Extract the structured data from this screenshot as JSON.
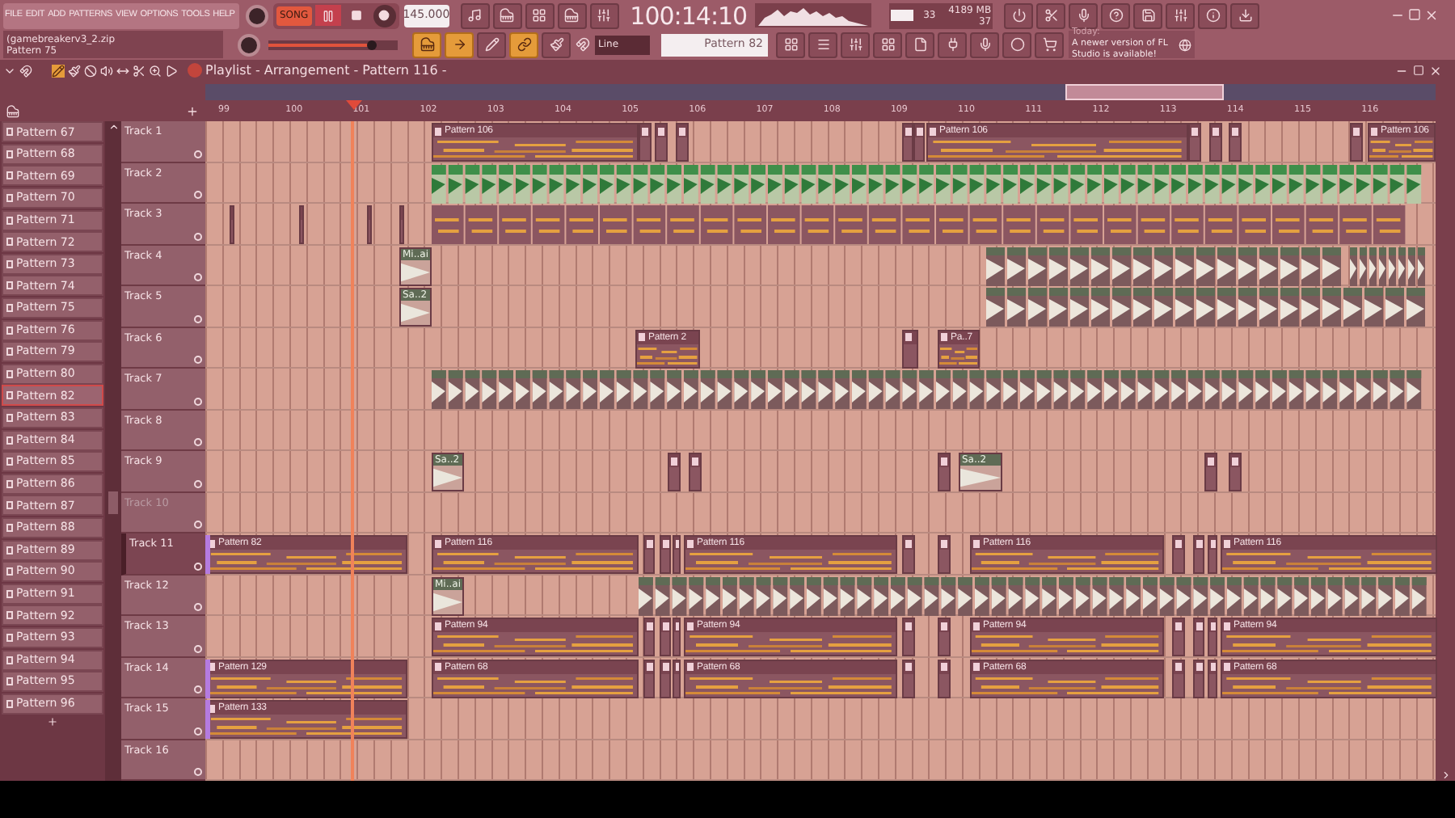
{
  "menu": [
    "FILE",
    "EDIT",
    "ADD",
    "PATTERNS",
    "VIEW",
    "OPTIONS",
    "TOOLS",
    "HELP"
  ],
  "transport": {
    "mode": "SONG",
    "tempo": "145.000",
    "time": "100:14:10"
  },
  "project": {
    "file": "(gamebreakerv3_2.zip",
    "hint": "Pattern 75"
  },
  "monitor": {
    "cpu": "33",
    "memory": "4189 MB",
    "polyphony": "37"
  },
  "snap": "Line",
  "volume": {
    "level": 0.8
  },
  "pattern_selector": "Pattern 82",
  "news": {
    "label": "Today:",
    "message": "A newer version of FL Studio is available!"
  },
  "playlist_title": "Playlist - Arrangement - Pattern 116 -",
  "ruler": [
    "99",
    "100",
    "101",
    "102",
    "103",
    "104",
    "105",
    "106",
    "107",
    "108",
    "109",
    "110",
    "111",
    "112",
    "113",
    "114",
    "115",
    "116"
  ],
  "patterns": [
    {
      "label": "Pattern 67",
      "selected": false
    },
    {
      "label": "Pattern 68",
      "selected": false
    },
    {
      "label": "Pattern 69",
      "selected": false
    },
    {
      "label": "Pattern 70",
      "selected": false
    },
    {
      "label": "Pattern 71",
      "selected": false
    },
    {
      "label": "Pattern 72",
      "selected": false
    },
    {
      "label": "Pattern 73",
      "selected": false
    },
    {
      "label": "Pattern 74",
      "selected": false
    },
    {
      "label": "Pattern 75",
      "selected": false
    },
    {
      "label": "Pattern 76",
      "selected": false
    },
    {
      "label": "Pattern 79",
      "selected": false
    },
    {
      "label": "Pattern 80",
      "selected": false
    },
    {
      "label": "Pattern 82",
      "selected": true
    },
    {
      "label": "Pattern 83",
      "selected": false
    },
    {
      "label": "Pattern 84",
      "selected": false
    },
    {
      "label": "Pattern 85",
      "selected": false
    },
    {
      "label": "Pattern 86",
      "selected": false
    },
    {
      "label": "Pattern 87",
      "selected": false
    },
    {
      "label": "Pattern 88",
      "selected": false
    },
    {
      "label": "Pattern 89",
      "selected": false
    },
    {
      "label": "Pattern 90",
      "selected": false
    },
    {
      "label": "Pattern 91",
      "selected": false
    },
    {
      "label": "Pattern 92",
      "selected": false
    },
    {
      "label": "Pattern 93",
      "selected": false
    },
    {
      "label": "Pattern 94",
      "selected": false
    },
    {
      "label": "Pattern 95",
      "selected": false
    },
    {
      "label": "Pattern 96",
      "selected": false
    }
  ],
  "tracks": [
    {
      "name": "Track 1",
      "muted": false,
      "selected": false,
      "clips": [
        {
          "kind": "pattern",
          "label": "Pattern 106"
        },
        {
          "kind": "pattern",
          "label": "Pattern 106"
        },
        {
          "kind": "pattern",
          "label": "Pattern 106"
        }
      ]
    },
    {
      "name": "Track 2",
      "muted": false,
      "selected": false
    },
    {
      "name": "Track 3",
      "muted": false,
      "selected": false
    },
    {
      "name": "Track 4",
      "muted": false,
      "selected": false,
      "clips": [
        {
          "kind": "audio",
          "label": "Mi..ai"
        }
      ]
    },
    {
      "name": "Track 5",
      "muted": false,
      "selected": false,
      "clips": [
        {
          "kind": "audio",
          "label": "Sa..2"
        }
      ]
    },
    {
      "name": "Track 6",
      "muted": false,
      "selected": false,
      "clips": [
        {
          "kind": "pattern",
          "label": "Pattern 2"
        },
        {
          "kind": "pattern",
          "label": "Pa..7"
        }
      ]
    },
    {
      "name": "Track 7",
      "muted": false,
      "selected": false
    },
    {
      "name": "Track 8",
      "muted": false,
      "selected": false
    },
    {
      "name": "Track 9",
      "muted": false,
      "selected": false,
      "clips": [
        {
          "kind": "audio",
          "label": "Sa..2"
        },
        {
          "kind": "audio",
          "label": "Sa..2"
        }
      ]
    },
    {
      "name": "Track 10",
      "muted": true,
      "selected": false
    },
    {
      "name": "Track 11",
      "muted": false,
      "selected": true,
      "clips": [
        {
          "kind": "pattern",
          "label": "Pattern 82"
        },
        {
          "kind": "pattern",
          "label": "Pattern 116"
        },
        {
          "kind": "pattern",
          "label": "Pattern 116"
        },
        {
          "kind": "pattern",
          "label": "Pattern 116"
        },
        {
          "kind": "pattern",
          "label": "Pattern 116"
        }
      ]
    },
    {
      "name": "Track 12",
      "muted": false,
      "selected": false,
      "clips": [
        {
          "kind": "audio",
          "label": "Mi..ai"
        }
      ]
    },
    {
      "name": "Track 13",
      "muted": false,
      "selected": false,
      "clips": [
        {
          "kind": "pattern",
          "label": "Pattern 94"
        },
        {
          "kind": "pattern",
          "label": "Pattern 94"
        },
        {
          "kind": "pattern",
          "label": "Pattern 94"
        },
        {
          "kind": "pattern",
          "label": "Pattern 94"
        }
      ]
    },
    {
      "name": "Track 14",
      "muted": false,
      "selected": false,
      "clips": [
        {
          "kind": "pattern",
          "label": "Pattern 129"
        },
        {
          "kind": "pattern",
          "label": "Pattern 68"
        },
        {
          "kind": "pattern",
          "label": "Pattern 68"
        },
        {
          "kind": "pattern",
          "label": "Pattern 68"
        },
        {
          "kind": "pattern",
          "label": "Pattern 68"
        }
      ]
    },
    {
      "name": "Track 15",
      "muted": false,
      "selected": false,
      "clips": [
        {
          "kind": "pattern",
          "label": "Pattern 133"
        }
      ]
    },
    {
      "name": "Track 16",
      "muted": false,
      "selected": false
    }
  ]
}
